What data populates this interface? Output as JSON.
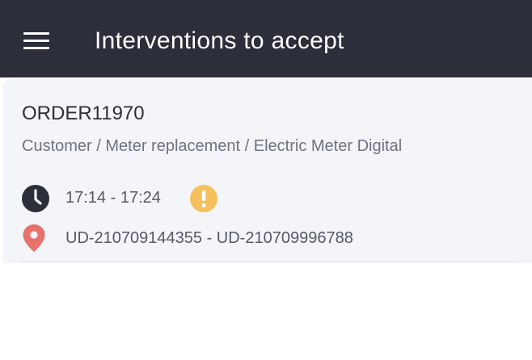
{
  "header": {
    "menu_icon": "hamburger-menu-icon",
    "title": "Interventions to accept"
  },
  "intervention": {
    "order_id": "ORDER11970",
    "type_path": "Customer / Meter replacement / Electric Meter Digital",
    "time_icon": "clock-icon",
    "time_range": "17:14 - 17:24",
    "alert_icon": "exclamation-alert-icon",
    "location_icon": "map-pin-icon",
    "address": "UD-210709144355 - UD-210709996788"
  },
  "colors": {
    "appbar": "#2c2f3a",
    "card_background": "#f4f5f8",
    "alert": "#f5c15c",
    "pin": "#e8716b",
    "clock": "#2c2f3a"
  }
}
